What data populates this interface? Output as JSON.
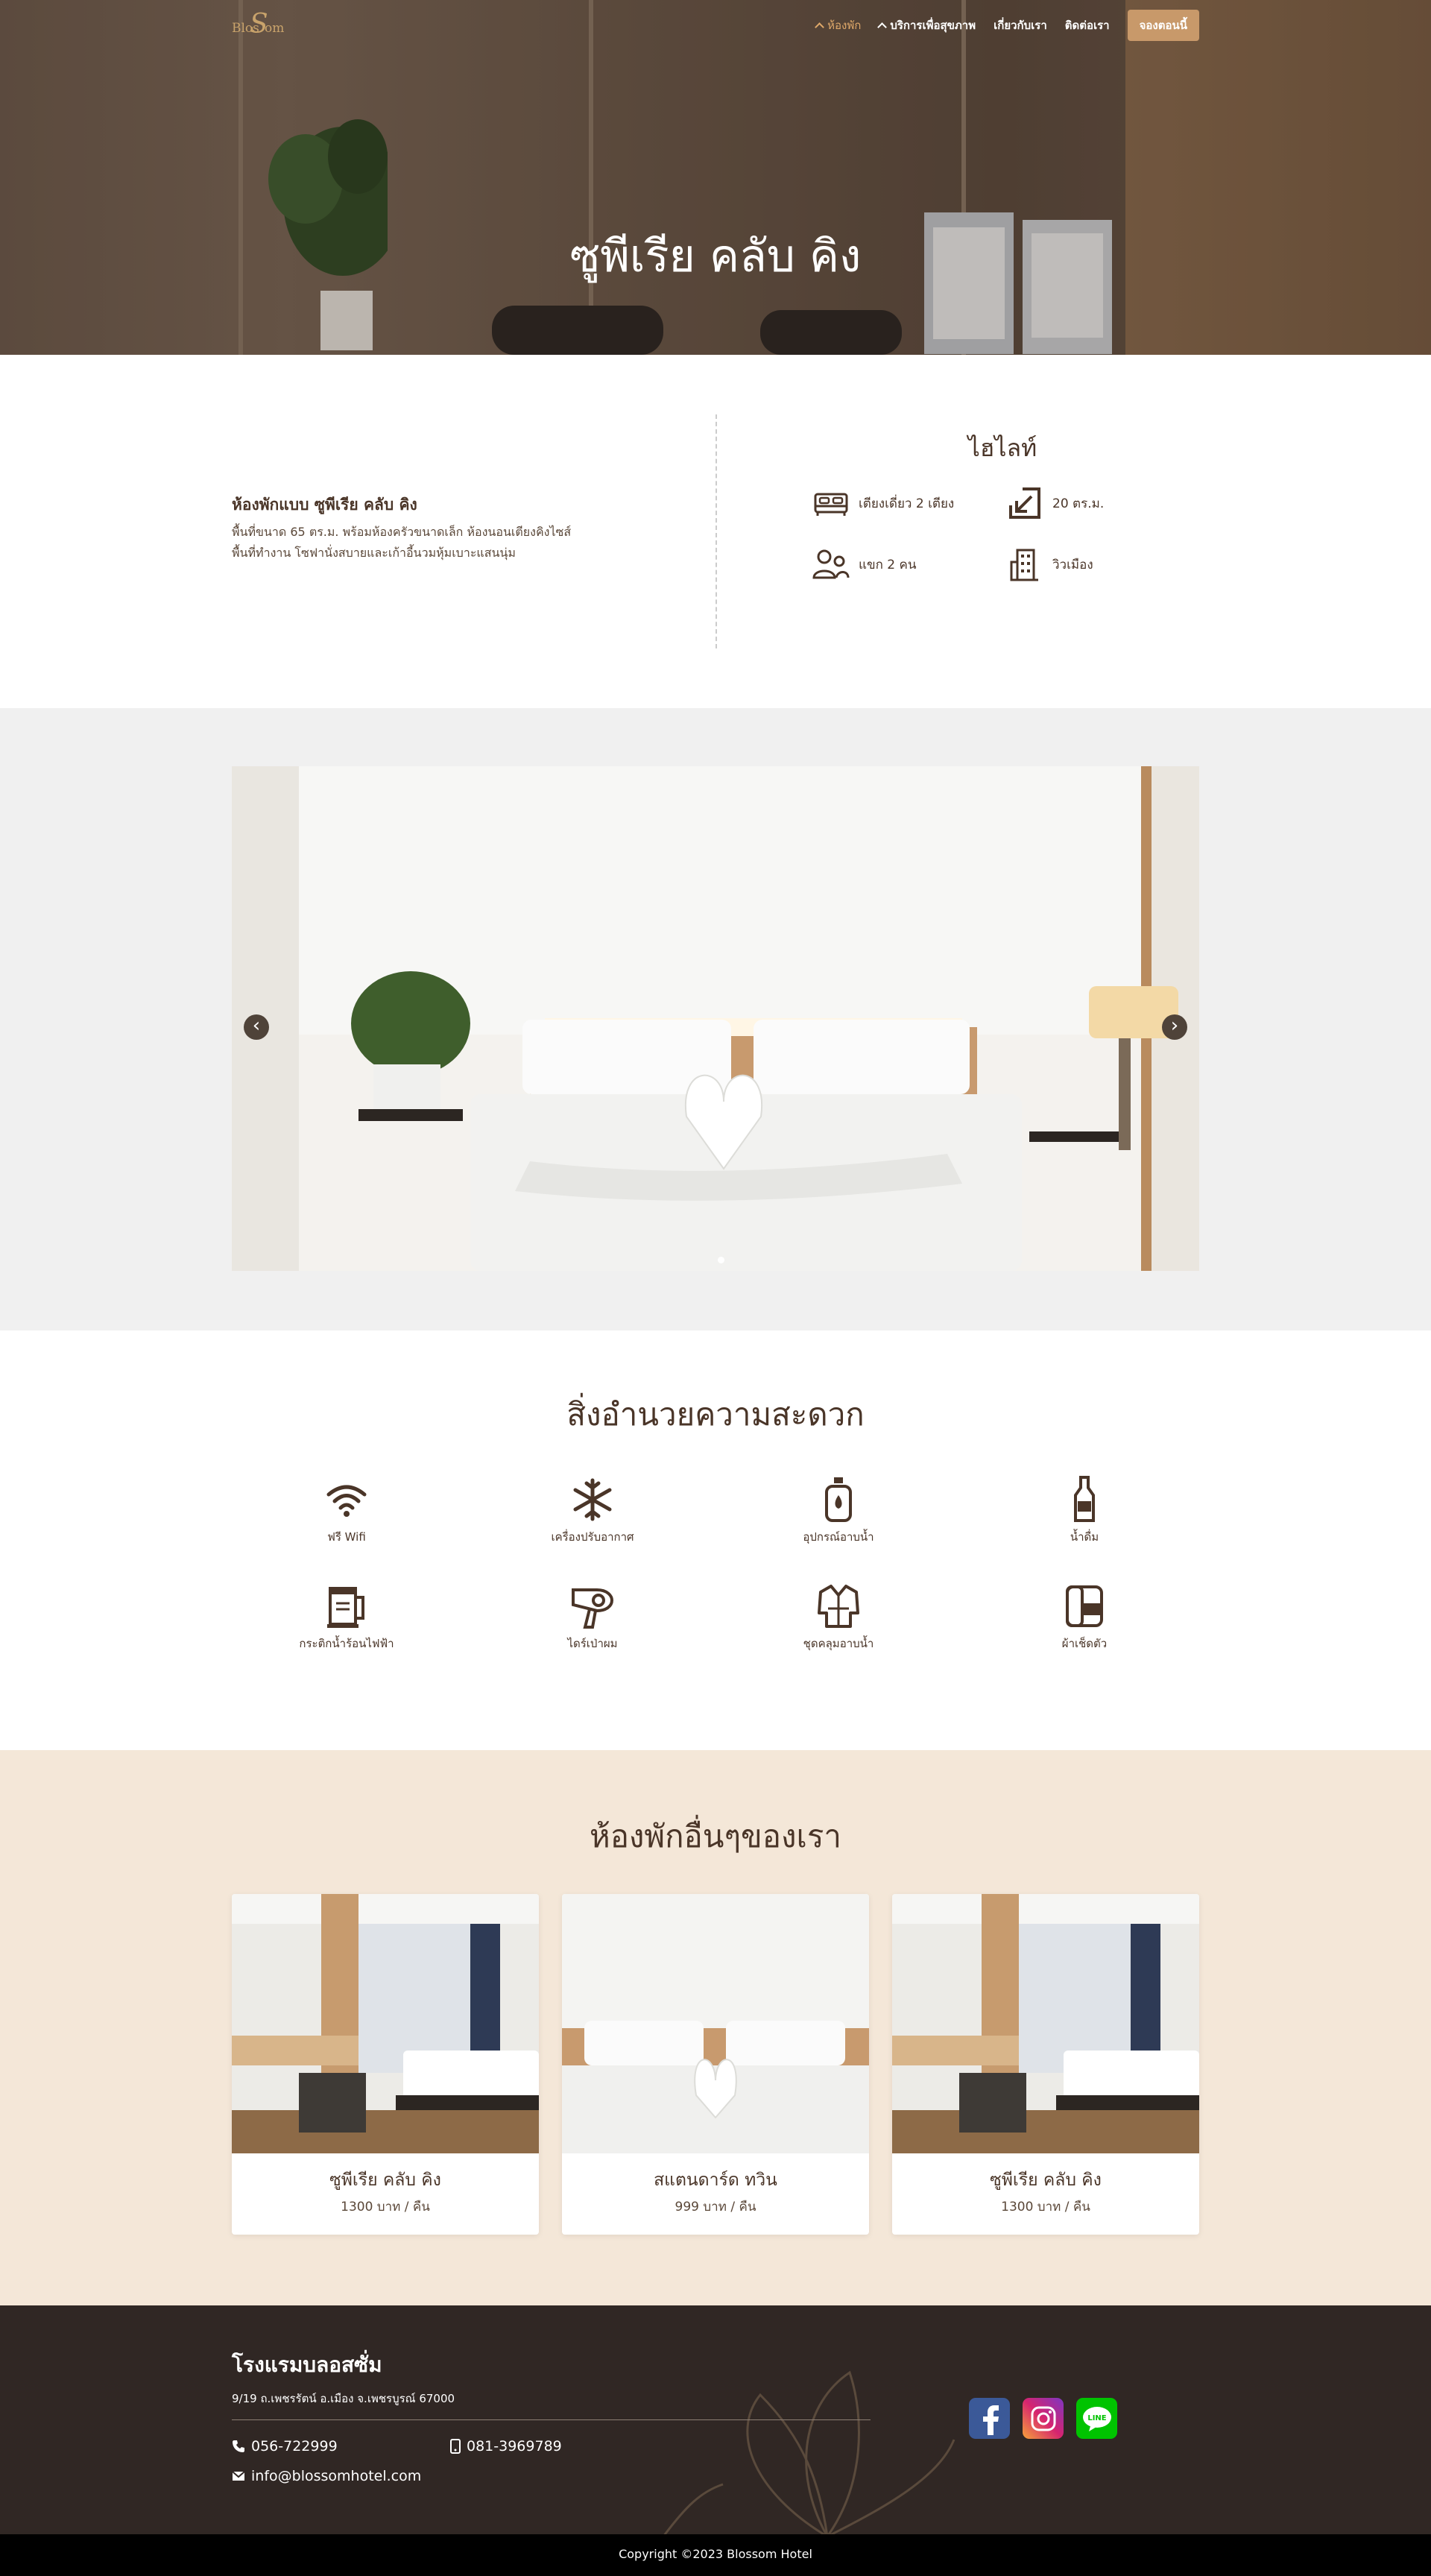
{
  "colors": {
    "brown": "#4a3528",
    "gold": "#c8996a",
    "accent": "#e0a96a",
    "footer_bg": "#302724",
    "beige": "#f4e7d8"
  },
  "header": {
    "logo_text": "BlosSom",
    "nav": [
      {
        "label": "ห้องพัก",
        "icon": "chevron-up-icon",
        "active": true
      },
      {
        "label": "บริการเพื่อสุขภาพ",
        "icon": "chevron-up-icon"
      },
      {
        "label": "เกี่ยวกับเรา"
      },
      {
        "label": "ติดต่อเรา"
      }
    ],
    "book_label": "จองตอนนี้"
  },
  "hero": {
    "title": "ซูพีเรีย คลับ คิง"
  },
  "info": {
    "room_title": "ห้องพักแบบ ซูพีเรีย คลับ คิง",
    "room_desc_1": "พื้นที่ขนาด 65 ตร.ม. พร้อมห้องครัวขนาดเล็ก ห้องนอนเตียงคิงไซส์",
    "room_desc_2": "พื้นที่ทำงาน โซฟานั่งสบายและเก้าอี้นวมหุ้มเบาะแสนนุ่ม",
    "highlight_title": "ไฮไลท์",
    "highlights": [
      {
        "icon": "bed-icon",
        "label": "เตียงเดี่ยว 2 เตียง"
      },
      {
        "icon": "area-icon",
        "label": "20 ตร.ม."
      },
      {
        "icon": "guests-icon",
        "label": "แขก 2 คน"
      },
      {
        "icon": "building-icon",
        "label": "วิวเมือง"
      }
    ]
  },
  "gallery": {
    "prev": "‹",
    "next": "›"
  },
  "amenities": {
    "title": "สิ่งอำนวยความสะดวก",
    "items": [
      {
        "icon": "wifi-icon",
        "label": "ฟรี Wifi"
      },
      {
        "icon": "snowflake-icon",
        "label": "เครื่องปรับอากาศ"
      },
      {
        "icon": "soap-icon",
        "label": "อุปกรณ์อาบน้ำ"
      },
      {
        "icon": "bottle-icon",
        "label": "น้ำดื่ม"
      },
      {
        "icon": "kettle-icon",
        "label": "กระติกน้ำร้อนไฟฟ้า"
      },
      {
        "icon": "hairdryer-icon",
        "label": "ไดร์เป่าผม"
      },
      {
        "icon": "bathrobe-icon",
        "label": "ชุดคลุมอาบน้ำ"
      },
      {
        "icon": "towel-icon",
        "label": "ผ้าเช็ดตัว"
      }
    ]
  },
  "rooms": {
    "title": "ห้องพักอื่นๆของเรา",
    "cards": [
      {
        "name": "ซูพีเรีย คลับ คิง",
        "price": "1300 บาท / คืน"
      },
      {
        "name": "สแตนดาร์ด ทวิน",
        "price": "999 บาท / คืน"
      },
      {
        "name": "ซูพีเรีย คลับ คิง",
        "price": "1300 บาท / คืน"
      }
    ]
  },
  "footer": {
    "hotel_name": "โรงแรมบลอสซั่ม",
    "address": "9/19 ถ.เพชรรัตน์ อ.เมือง จ.เพชรบูรณ์ 67000",
    "phone": "056-722999",
    "mobile": "081-3969789",
    "email": "info@blossomhotel.com",
    "social": [
      {
        "icon": "facebook-icon",
        "color": "#3b5998"
      },
      {
        "icon": "instagram-icon",
        "color": "#c13584"
      },
      {
        "icon": "line-icon",
        "color": "#00c300"
      }
    ],
    "copyright": "Copyright ©2023 Blossom Hotel"
  }
}
